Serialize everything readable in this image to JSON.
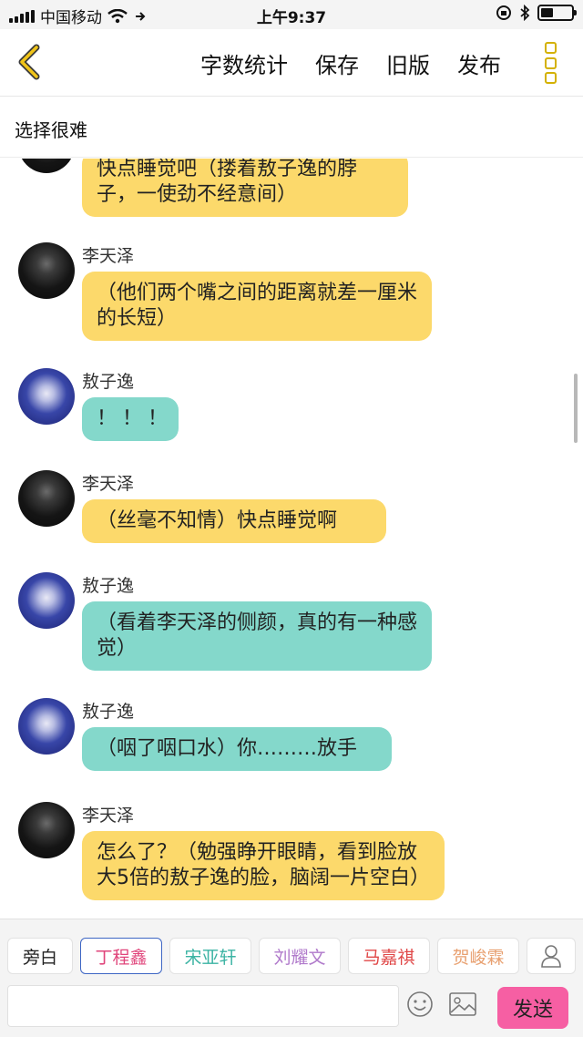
{
  "status_bar": {
    "carrier": "中国移动",
    "time": "上午9:37",
    "icons": [
      "signal-icon",
      "wifi-icon",
      "location-arrow-icon",
      "orientation-lock-icon",
      "bluetooth-icon",
      "battery-icon"
    ]
  },
  "navbar": {
    "back_icon": "chevron-left-icon",
    "actions": [
      "字数统计",
      "保存",
      "旧版",
      "发布"
    ],
    "more_icon": "more-vertical-icon",
    "accent_color": "#d4b100"
  },
  "story": {
    "title": "选择很难"
  },
  "messages": [
    {
      "speaker": "",
      "avatar": "dark",
      "color": "yellow",
      "text": "快点睡觉吧（搂着敖子逸的脖子，一使劲不经意间）"
    },
    {
      "speaker": "李天泽",
      "avatar": "dark",
      "color": "yellow",
      "text": "（他们两个嘴之间的距离就差一厘米的长短）"
    },
    {
      "speaker": "敖子逸",
      "avatar": "blue",
      "color": "teal",
      "text": "！！！"
    },
    {
      "speaker": "李天泽",
      "avatar": "dark",
      "color": "yellow",
      "text": "（丝毫不知情）快点睡觉啊"
    },
    {
      "speaker": "敖子逸",
      "avatar": "blue",
      "color": "teal",
      "text": "（看着李天泽的侧颜，真的有一种感觉）"
    },
    {
      "speaker": "敖子逸",
      "avatar": "blue",
      "color": "teal",
      "text": "（咽了咽口水）你………放手"
    },
    {
      "speaker": "李天泽",
      "avatar": "dark",
      "color": "yellow",
      "text": "怎么了？（勉强睁开眼睛，看到脸放大5倍的敖子逸的脸，脑阔一片空白）"
    }
  ],
  "bubble_colors": {
    "yellow": "#fcd96b",
    "teal": "#84d8cb"
  },
  "roles": [
    {
      "label": "旁白",
      "color": "#222222"
    },
    {
      "label": "丁程鑫",
      "color": "#e0457b"
    },
    {
      "label": "宋亚轩",
      "color": "#3bb3a3"
    },
    {
      "label": "刘耀文",
      "color": "#b07acb"
    },
    {
      "label": "马嘉祺",
      "color": "#e04848"
    },
    {
      "label": "贺峻霖",
      "color": "#e8a070"
    }
  ],
  "composer": {
    "input_value": "",
    "emoji_icon": "smiley-icon",
    "image_icon": "image-icon",
    "add_role_icon": "person-icon",
    "send_label": "发送",
    "send_color": "#f65fa3"
  }
}
